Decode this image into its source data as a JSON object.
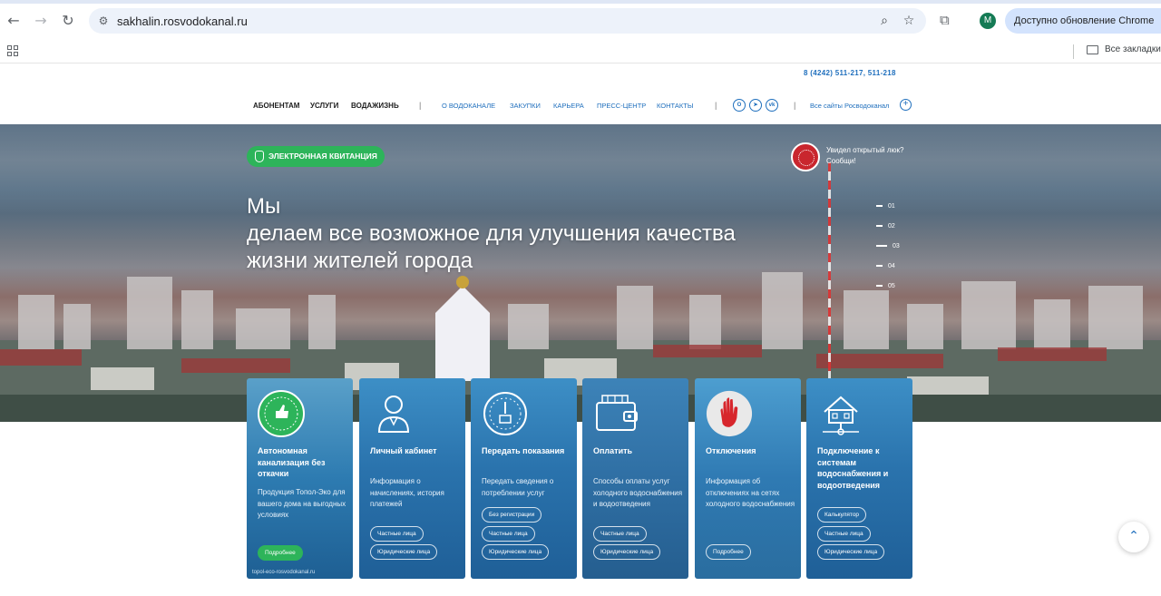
{
  "browser": {
    "back_glyph": "←",
    "forward_glyph": "→",
    "reload_glyph": "↻",
    "site_info_glyph": "⚙",
    "url": "sakhalin.rosvodokanal.ru",
    "zoom_glyph": "⌕",
    "star_glyph": "☆",
    "extensions_glyph": "⧉",
    "profile_initial": "M",
    "update_label": "Доступно обновление Chrome",
    "bookmarks_all": "Все закладки"
  },
  "header": {
    "phone": "8 (4242) 511-217, 511-218",
    "main_menu": [
      "АБОНЕНТАМ",
      "УСЛУГИ",
      "ВОДАЖИЗНЬ"
    ],
    "separator": "|",
    "secondary_menu": [
      "О ВОДОКАНАЛЕ",
      "ЗАКУПКИ",
      "КАРЬЕРА",
      "ПРЕСС-ЦЕНТР",
      "КОНТАКТЫ"
    ],
    "social": [
      "ok",
      "tg",
      "vk"
    ],
    "social_glyphs": [
      "О",
      "➤",
      "vk"
    ],
    "all_sites": "Все сайты Росводоканал",
    "plus_glyph": "+"
  },
  "hero": {
    "ekv_button": "ЭЛЕКТРОННАЯ КВИТАНЦИЯ",
    "title_line1": "Мы",
    "title_line2": "делаем все возможное для улучшения качества",
    "title_line3": "жизни жителей города",
    "leak_line1": "Увидел открытый люк?",
    "leak_line2": "Сообщи!",
    "slides": [
      "01",
      "02",
      "03",
      "04",
      "05"
    ],
    "active_slide": "03"
  },
  "cards": [
    {
      "title": "Автономная канализация без откачки",
      "desc": "Продукция Топол-Эко для вашего дома на выгодных условиях",
      "buttons": [
        "Подробнее"
      ],
      "foot": "topol-eco-rosvodokanal.ru",
      "icon": "topas-badge-icon"
    },
    {
      "title": "Личный кабинет",
      "desc": "Информация о начислениях, история платежей",
      "buttons": [
        "Частные лица",
        "Юридические лица"
      ],
      "icon": "user-icon"
    },
    {
      "title": "Передать показания",
      "desc": "Передать сведения о потреблении услуг",
      "buttons": [
        "Без регистрации",
        "Частные лица",
        "Юридические лица"
      ],
      "icon": "meter-icon"
    },
    {
      "title": "Оплатить",
      "desc": "Способы оплаты услуг холодного водоснабжения и водоотведения",
      "buttons": [
        "Частные лица",
        "Юридические лица"
      ],
      "icon": "wallet-icon"
    },
    {
      "title": "Отключения",
      "desc": "Информация об отключениях на сетях холодного водоснабжения",
      "buttons": [
        "Подробнее"
      ],
      "icon": "hand-stop-icon"
    },
    {
      "title": "Подключение к системам водоснабжения и водоотведения",
      "desc": "",
      "buttons": [
        "Калькулятор",
        "Частные лица",
        "Юридические лица"
      ],
      "icon": "house-connection-icon"
    }
  ],
  "scroll_top_glyph": "⌃",
  "colors": {
    "accent_blue": "#1f6fbd",
    "green": "#2db45a",
    "red": "#c9262e"
  }
}
